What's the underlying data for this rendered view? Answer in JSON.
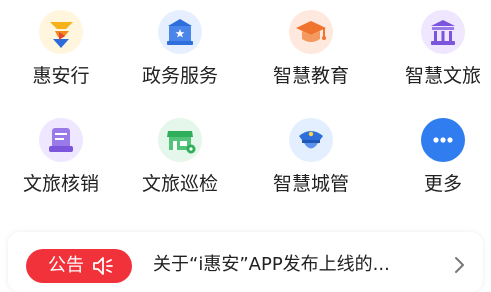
{
  "grid": {
    "row1": [
      {
        "label": "惠安行",
        "icon": "inverted-triangle-logo-icon",
        "bg": "#fff6dd"
      },
      {
        "label": "政务服务",
        "icon": "government-building-icon",
        "bg": "#e6efff"
      },
      {
        "label": "智慧教育",
        "icon": "graduation-cap-icon",
        "bg": "#ffe8dd"
      },
      {
        "label": "智慧文旅",
        "icon": "museum-icon",
        "bg": "#efe6ff"
      }
    ],
    "row2": [
      {
        "label": "文旅核销",
        "icon": "document-stack-icon",
        "bg": "#efe6ff"
      },
      {
        "label": "文旅巡检",
        "icon": "storefront-location-icon",
        "bg": "#e5f6ea"
      },
      {
        "label": "智慧城管",
        "icon": "officer-cap-icon",
        "bg": "#e3efff"
      },
      {
        "label": "更多",
        "icon": "more-dots-icon",
        "bg": "#2f7dee"
      }
    ]
  },
  "notice": {
    "badge_label": "公告",
    "badge_color": "#f2323a",
    "badge_icon": "speaker-icon",
    "text": "关于“i惠安”APP发布上线的...",
    "arrow_icon": "chevron-right-icon"
  }
}
